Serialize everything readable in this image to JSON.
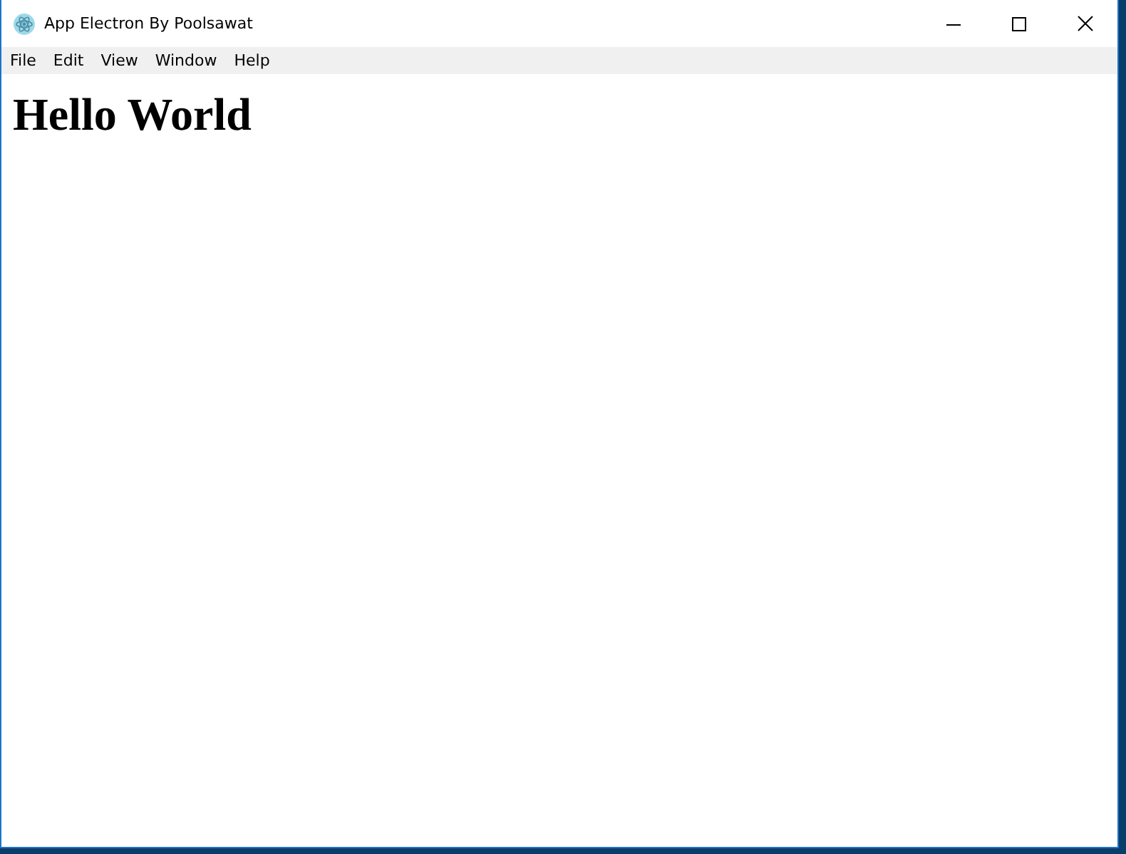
{
  "window": {
    "title": "App Electron By Poolsawat"
  },
  "menu": [
    {
      "label": "File"
    },
    {
      "label": "Edit"
    },
    {
      "label": "View"
    },
    {
      "label": "Window"
    },
    {
      "label": "Help"
    }
  ],
  "content": {
    "heading": "Hello World"
  }
}
